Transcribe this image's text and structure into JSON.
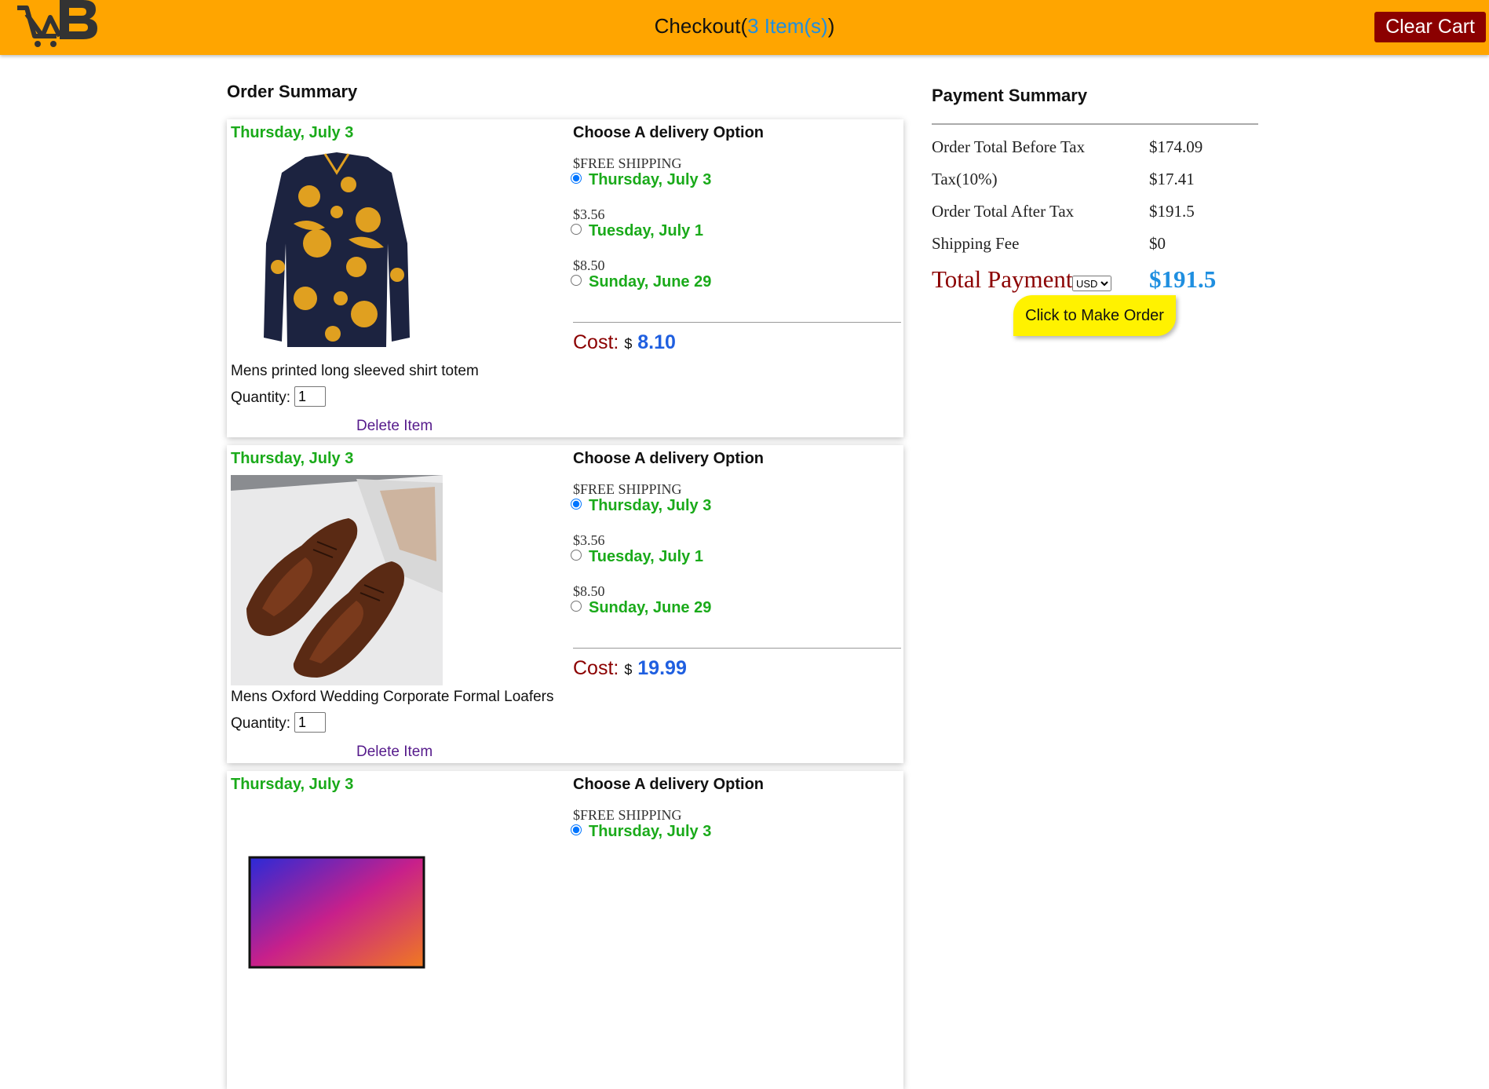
{
  "header": {
    "logo_icon": "store-logo-cart-icon",
    "checkout_label": "Checkout(",
    "item_count": "3 Item(s)",
    "checkout_close": ")",
    "clear_cart_label": "Clear Cart",
    "bar_color": "#ffa500"
  },
  "order": {
    "title": "Order Summary",
    "delivery_title": "Choose A delivery Option",
    "quantity_label": "Quantity:",
    "delete_label": "Delete Item",
    "cost_label": "Cost",
    "currency_symbol": "$",
    "items": [
      {
        "date": "Thursday, July 3",
        "image_icon": "patterned-shirt-image",
        "name": "Mens printed long sleeved shirt totem",
        "quantity": "1",
        "cost": "8.10",
        "options": [
          {
            "price": "FREE SHIPPING",
            "date": "Thursday, July 3",
            "selected": true
          },
          {
            "price": "3.56",
            "date": "Tuesday, July 1",
            "selected": false
          },
          {
            "price": "8.50",
            "date": "Sunday, June 29",
            "selected": false
          }
        ]
      },
      {
        "date": "Thursday, July 3",
        "image_icon": "brown-oxford-shoes-image",
        "name": "Mens Oxford Wedding Corporate Formal Loafers",
        "quantity": "1",
        "cost": "19.99",
        "options": [
          {
            "price": "FREE SHIPPING",
            "date": "Thursday, July 3",
            "selected": true
          },
          {
            "price": "3.56",
            "date": "Tuesday, July 1",
            "selected": false
          },
          {
            "price": "8.50",
            "date": "Sunday, June 29",
            "selected": false
          }
        ]
      },
      {
        "date": "Thursday, July 3",
        "image_icon": "laptop-image",
        "options": [
          {
            "price": "FREE SHIPPING",
            "date": "Thursday, July 3",
            "selected": true
          }
        ]
      }
    ]
  },
  "payment": {
    "title": "Payment Summary",
    "rows": [
      {
        "label": "Order Total Before Tax",
        "value": "$174.09"
      },
      {
        "label": "Tax(10%)",
        "value": "$17.41"
      },
      {
        "label": "Order Total After Tax",
        "value": "$191.5"
      },
      {
        "label": "Shipping Fee",
        "value": "$0"
      }
    ],
    "total_label": "Total Payment",
    "currency_selected": "USD",
    "total_value": "$191.5",
    "make_order_label": "Click to Make Order"
  }
}
